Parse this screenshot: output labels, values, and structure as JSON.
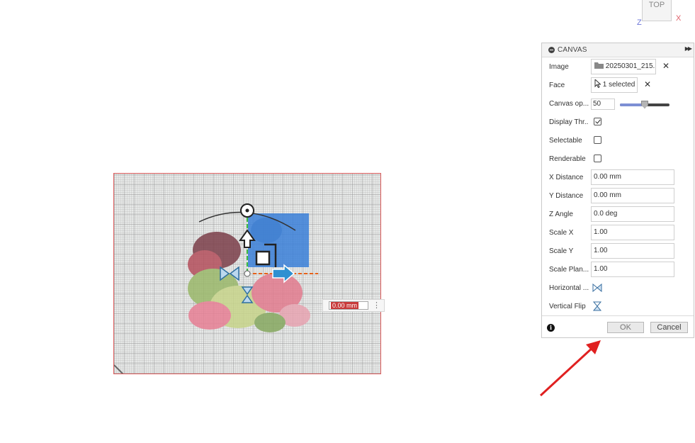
{
  "viewcube": {
    "face_label": "TOP",
    "axis_x": "X",
    "axis_z": "Z"
  },
  "canvas": {
    "dimension_value": "0.00 mm"
  },
  "panel": {
    "title": "CANVAS",
    "image": {
      "label": "Image",
      "value": "20250301_215..."
    },
    "face": {
      "label": "Face",
      "value": "1 selected"
    },
    "opacity": {
      "label": "Canvas op...",
      "value": "50",
      "slider_fraction": 0.5
    },
    "display_through": {
      "label": "Display Thr...",
      "checked": true
    },
    "selectable": {
      "label": "Selectable",
      "checked": false
    },
    "renderable": {
      "label": "Renderable",
      "checked": false
    },
    "x_distance": {
      "label": "X Distance",
      "value": "0.00 mm"
    },
    "y_distance": {
      "label": "Y Distance",
      "value": "0.00 mm"
    },
    "z_angle": {
      "label": "Z Angle",
      "value": "0.0 deg"
    },
    "scale_x": {
      "label": "Scale X",
      "value": "1.00"
    },
    "scale_y": {
      "label": "Scale Y",
      "value": "1.00"
    },
    "scale_plane": {
      "label": "Scale Plan...",
      "value": "1.00"
    },
    "horizontal_flip": {
      "label": "Horizontal ..."
    },
    "vertical_flip": {
      "label": "Vertical Flip"
    },
    "ok_label": "OK",
    "cancel_label": "Cancel",
    "close_symbol": "✕"
  },
  "colors": {
    "accent_blue": "#2e90d1",
    "selection_red": "#c83a3a",
    "annotation_arrow": "#e02020",
    "slider_fill": "#7d8fd4"
  }
}
